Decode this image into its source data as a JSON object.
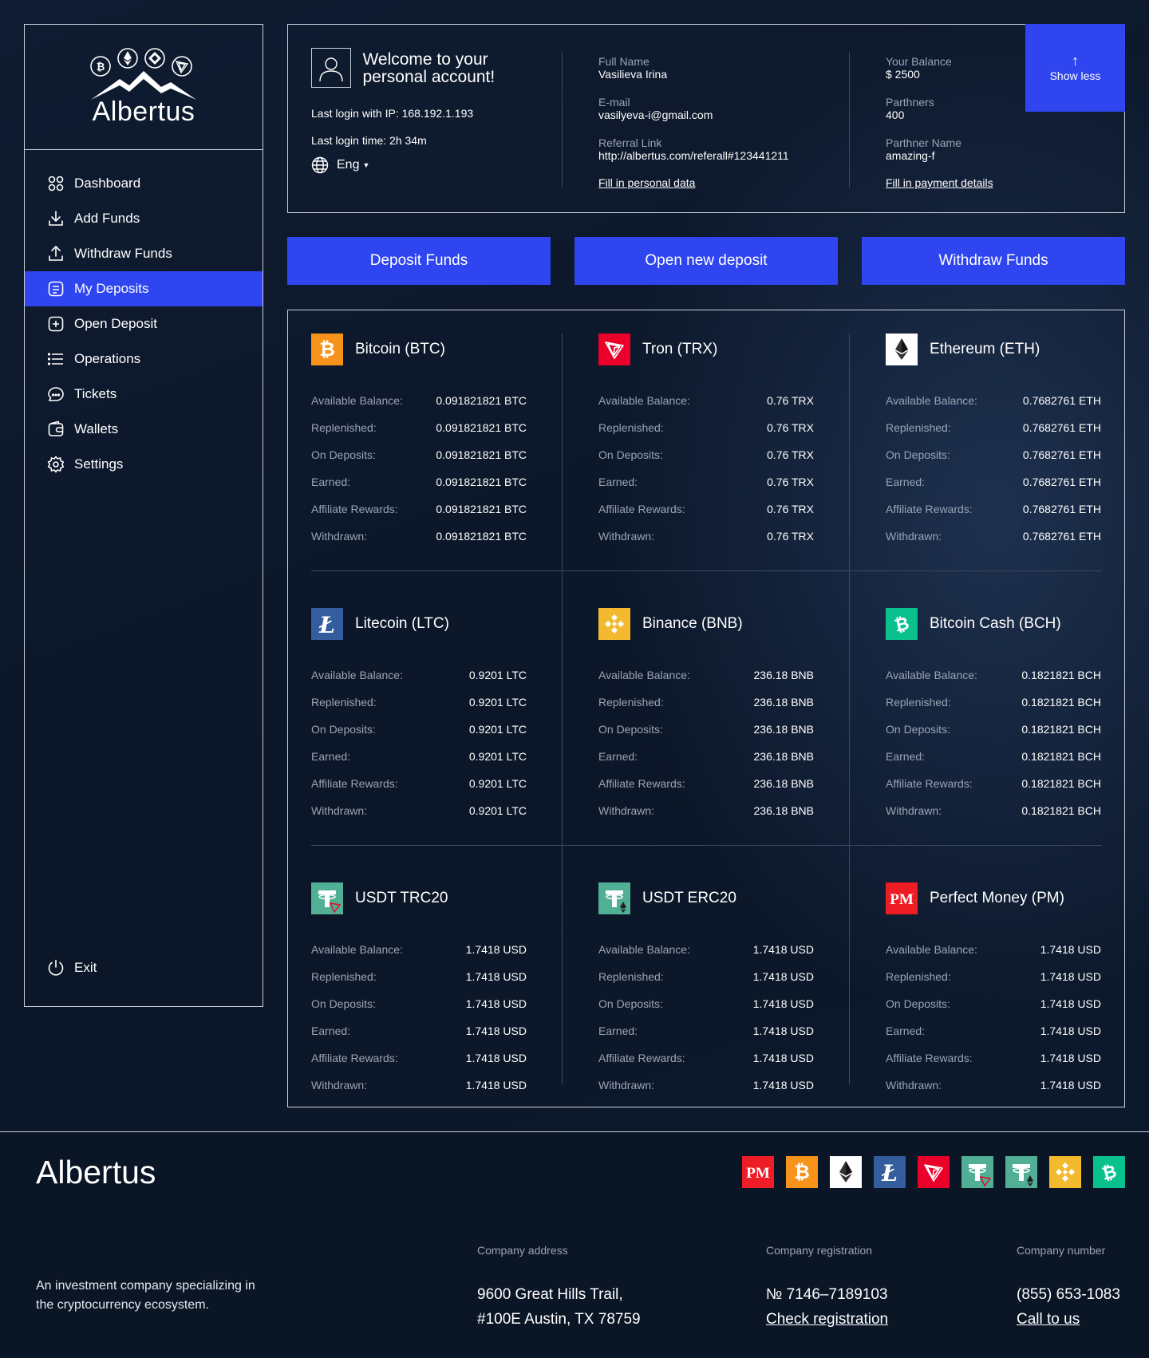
{
  "brand": {
    "name": "Albertus"
  },
  "sidebar": {
    "items": [
      {
        "label": "Dashboard",
        "icon": "dashboard-icon"
      },
      {
        "label": "Add Funds",
        "icon": "download-icon"
      },
      {
        "label": "Withdraw Funds",
        "icon": "upload-icon"
      },
      {
        "label": "My Deposits",
        "icon": "deposits-icon",
        "active": true
      },
      {
        "label": "Open Deposit",
        "icon": "plus-square-icon"
      },
      {
        "label": "Operations",
        "icon": "list-icon"
      },
      {
        "label": "Tickets",
        "icon": "chat-icon"
      },
      {
        "label": "Wallets",
        "icon": "wallet-icon"
      },
      {
        "label": "Settings",
        "icon": "gear-icon"
      }
    ],
    "exit_label": "Exit"
  },
  "account": {
    "welcome": "Welcome to your personal account!",
    "last_ip": "Last login with IP: 168.192.1.193",
    "last_time": "Last login time: 2h 34m",
    "language": "Eng",
    "full_name_label": "Full Name",
    "full_name": "Vasilieva Irina",
    "email_label": "E-mail",
    "email": "vasilyeva-i@gmail.com",
    "referral_label": "Referral Link",
    "referral": "http://albertus.com/referall#123441211",
    "fill_personal": "Fill in personal data",
    "balance_label": "Your Balance",
    "balance": "$ 2500",
    "partners_label": "Parthners",
    "partners": "400",
    "partner_name_label": "Parthner Name",
    "partner_name": "amazing-f",
    "fill_payment": "Fill in payment details",
    "show_less": "Show less"
  },
  "actions": {
    "deposit": "Deposit Funds",
    "open": "Open new deposit",
    "withdraw": "Withdraw Funds"
  },
  "row_labels": [
    "Available Balance:",
    "Replenished:",
    "On Deposits:",
    "Earned:",
    "Affiliate Rewards:",
    "Withdrawn:"
  ],
  "currencies": [
    {
      "name": "Bitcoin (BTC)",
      "icon": "bitcoin-icon",
      "color": "#f7931a",
      "value": "0.091821821 BTC"
    },
    {
      "name": "Tron (TRX)",
      "icon": "tron-icon",
      "color": "#eb0029",
      "value": "0.76 TRX"
    },
    {
      "name": "Ethereum (ETH)",
      "icon": "ethereum-icon",
      "color": "#ffffff",
      "value": "0.7682761 ETH"
    },
    {
      "name": "Litecoin (LTC)",
      "icon": "litecoin-icon",
      "color": "#345d9d",
      "value": "0.9201 LTC"
    },
    {
      "name": "Binance (BNB)",
      "icon": "binance-icon",
      "color": "#f3ba2f",
      "value": "236.18 BNB"
    },
    {
      "name": "Bitcoin Cash (BCH)",
      "icon": "bitcoin-cash-icon",
      "color": "#0ac18e",
      "value": "0.1821821 BCH"
    },
    {
      "name": "USDT TRC20",
      "icon": "usdt-trc20-icon",
      "color": "#50af95",
      "value": "1.7418 USD"
    },
    {
      "name": "USDT ERC20",
      "icon": "usdt-erc20-icon",
      "color": "#50af95",
      "value": "1.7418 USD"
    },
    {
      "name": "Perfect Money (PM)",
      "icon": "perfect-money-icon",
      "color": "#ee1c25",
      "value": "1.7418 USD"
    }
  ],
  "icon_glyphs": {
    "pm": "PM"
  },
  "footer": {
    "brand": "Albertus",
    "description": "An investment company specializing in the cryptocurrency ecosystem.",
    "address_label": "Company address",
    "address_line1": "9600 Great Hills Trail,",
    "address_line2": "#100E Austin, TX 78759",
    "registration_label": "Company registration",
    "registration_no": "№ 7146–7189103",
    "check_registration": "Check registration",
    "number_label": "Company number",
    "phone": "(855) 653-1083",
    "call_us": "Call to us",
    "payment_icons": [
      "perfect-money-icon",
      "bitcoin-icon",
      "ethereum-icon",
      "litecoin-icon",
      "tron-icon",
      "usdt-trc20-icon",
      "usdt-erc20-icon",
      "binance-icon",
      "bitcoin-cash-icon"
    ]
  },
  "colors": {
    "accent": "#2e45f0",
    "background": "#0b1628",
    "muted_text": "#9aa4b5",
    "border": "#c9ced8"
  }
}
